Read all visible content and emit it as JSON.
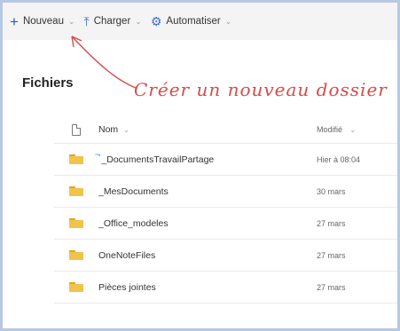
{
  "toolbar": {
    "new_label": "Nouveau",
    "upload_label": "Charger",
    "automate_label": "Automatiser"
  },
  "page_title": "Fichiers",
  "annotation": "Créer un nouveau dossier",
  "columns": {
    "name": "Nom",
    "modified": "Modifié"
  },
  "rows": [
    {
      "name": "_DocumentsTravailPartage",
      "modified": "Hier à 08:04",
      "shared": true
    },
    {
      "name": "_MesDocuments",
      "modified": "30 mars",
      "shared": false
    },
    {
      "name": "_Office_modeles",
      "modified": "27 mars",
      "shared": false
    },
    {
      "name": "OneNoteFiles",
      "modified": "27 mars",
      "shared": false
    },
    {
      "name": "Pièces jointes",
      "modified": "27 mars",
      "shared": false
    }
  ],
  "colors": {
    "accent": "#2b5fb4",
    "annotation": "#d94a4a",
    "folder": "#f3c24b"
  }
}
